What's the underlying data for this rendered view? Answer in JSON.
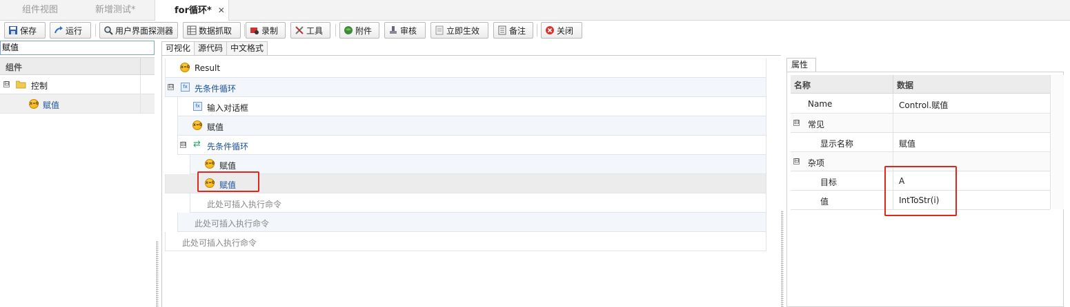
{
  "tabs": [
    {
      "label": "组件视图"
    },
    {
      "label": "新增测试*"
    },
    {
      "label": "for循环*",
      "close": "✕"
    }
  ],
  "toolbar": {
    "save": "保存",
    "run": "运行",
    "ui_detector": "用户界面探测器",
    "data_capture": "数据抓取",
    "record": "录制",
    "tools": "工具",
    "attachment": "附件",
    "review": "审核",
    "apply_now": "立即生效",
    "note": "备注",
    "close": "关闭"
  },
  "left": {
    "search_value": "赋值",
    "header": "组件",
    "tree": [
      {
        "label": "控制",
        "expander": "⊟"
      },
      {
        "label": "赋值"
      }
    ]
  },
  "center": {
    "view_tabs": [
      "可视化",
      "源代码",
      "中文格式"
    ],
    "rows": [
      {
        "label": "Result",
        "icon": "assign-icon"
      },
      {
        "label": "先条件循环",
        "icon": "loop-icon",
        "expander": "⊟"
      },
      {
        "label": "输入对话框",
        "icon": "dialog-icon"
      },
      {
        "label": "赋值",
        "icon": "assign-icon"
      },
      {
        "label": "先条件循环",
        "icon": "loop-icon",
        "expander": "⊟"
      },
      {
        "label": "赋值",
        "icon": "assign-icon"
      },
      {
        "label": "赋值",
        "icon": "assign-icon",
        "selected": true
      },
      {
        "label": "此处可插入执行命令"
      },
      {
        "label": "此处可插入执行命令"
      },
      {
        "label": "此处可插入执行命令"
      }
    ]
  },
  "properties": {
    "tab": "属性",
    "col_name": "名称",
    "col_data": "数据",
    "rows": [
      {
        "name": "Name",
        "value": "Control.赋值"
      },
      {
        "name": "常见",
        "expander": "⊟"
      },
      {
        "name": "显示名称",
        "value": "赋值"
      },
      {
        "name": "杂项",
        "expander": "⊟"
      },
      {
        "name": "目标",
        "value": "A"
      },
      {
        "name": "值",
        "value": "IntToStr(i)"
      }
    ]
  },
  "colors": {
    "highlight_box": "#e0251b",
    "link_blue": "#1a4f9a"
  }
}
